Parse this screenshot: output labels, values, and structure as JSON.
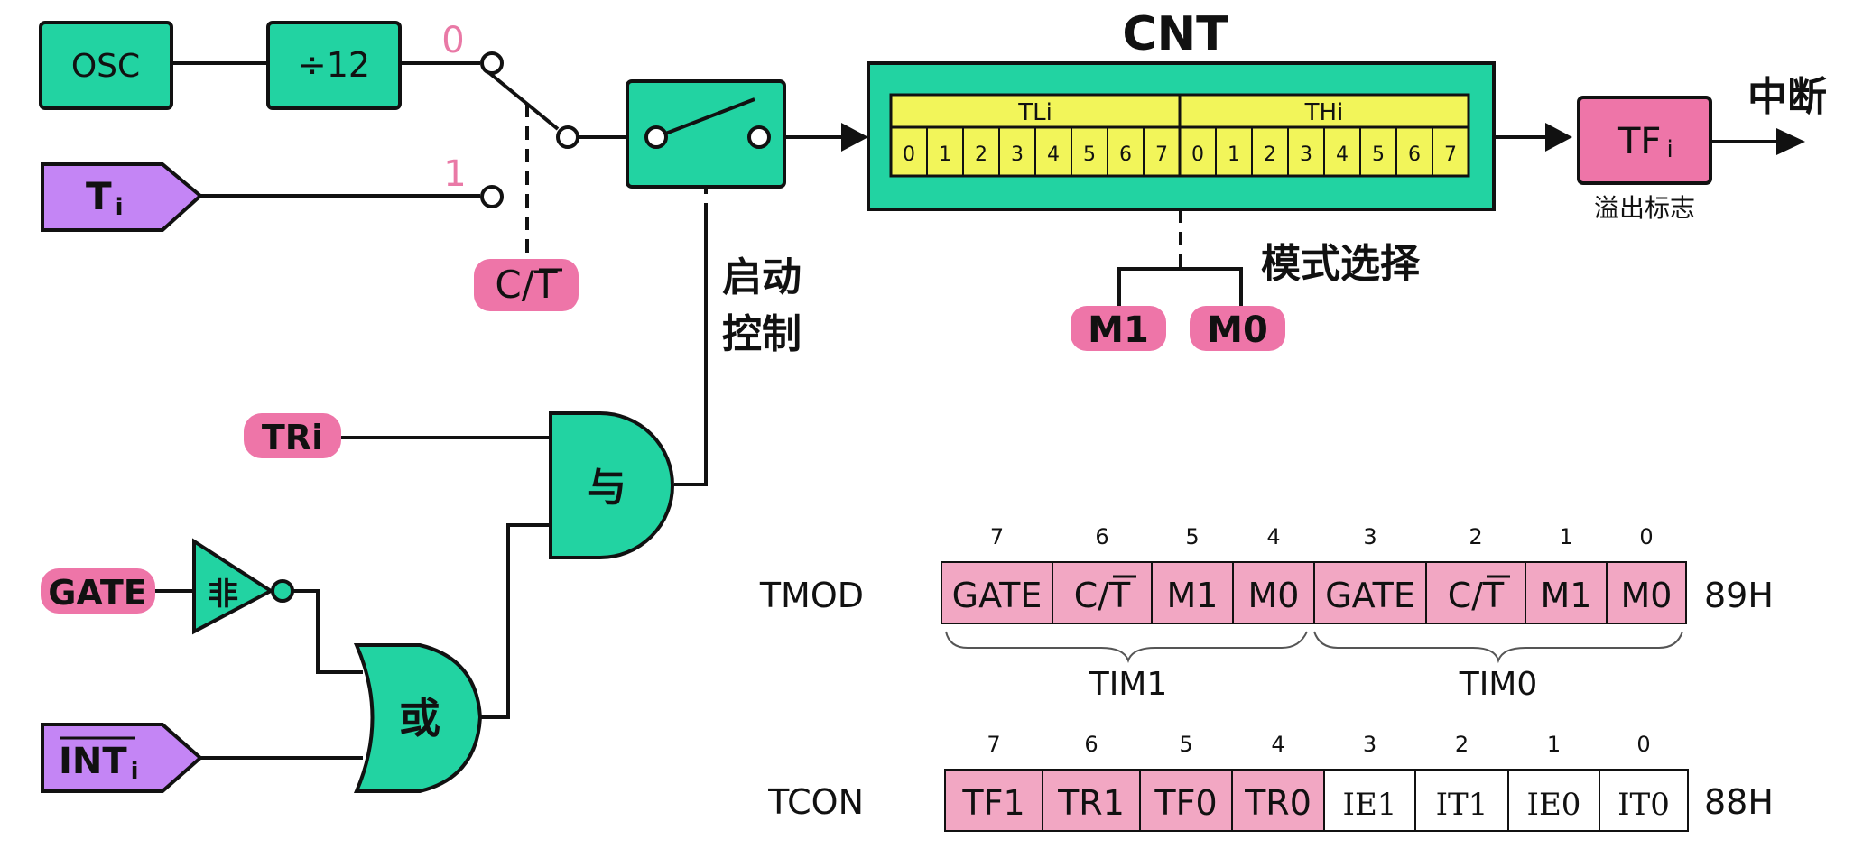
{
  "blocks": {
    "osc": "OSC",
    "div12": "÷12",
    "sel0": "0",
    "sel1": "1",
    "ti_main": "T",
    "ti_sub": "i",
    "ct": "C/T",
    "start_ctrl_line1": "启动",
    "start_ctrl_line2": "控制",
    "tri": "TRi",
    "gate": "GATE",
    "not_label": "非",
    "int_main": "INT",
    "int_sub": "i",
    "and_label": "与",
    "or_label": "或"
  },
  "counter": {
    "title": "CNT",
    "tl_label": "TLi",
    "th_label": "THi",
    "tl_bits": [
      "0",
      "1",
      "2",
      "3",
      "4",
      "5",
      "6",
      "7"
    ],
    "th_bits": [
      "0",
      "1",
      "2",
      "3",
      "4",
      "5",
      "6",
      "7"
    ],
    "mode_select": "模式选择",
    "m1": "M1",
    "m0": "M0"
  },
  "overflow": {
    "tf_main": "TF",
    "tf_sub": "i",
    "caption": "溢出标志",
    "interrupt": "中断"
  },
  "tmod": {
    "name": "TMOD",
    "address": "89H",
    "bit_numbers": [
      "7",
      "6",
      "5",
      "4",
      "3",
      "2",
      "1",
      "0"
    ],
    "cells": [
      "GATE",
      "C/T",
      "M1",
      "M0",
      "GATE",
      "C/T",
      "M1",
      "M0"
    ],
    "group_left": "TIM1",
    "group_right": "TIM0"
  },
  "tcon": {
    "name": "TCON",
    "address": "88H",
    "bit_numbers": [
      "7",
      "6",
      "5",
      "4",
      "3",
      "2",
      "1",
      "0"
    ],
    "cells": [
      "TF1",
      "TR1",
      "TF0",
      "TR0",
      "IE1",
      "IT1",
      "IE0",
      "IT0"
    ]
  },
  "colors": {
    "green": "#22d3a2",
    "pink": "#ee75a8",
    "pink_light": "#f2a7c3",
    "purple": "#c485f5",
    "yellow": "#f2f55a"
  }
}
